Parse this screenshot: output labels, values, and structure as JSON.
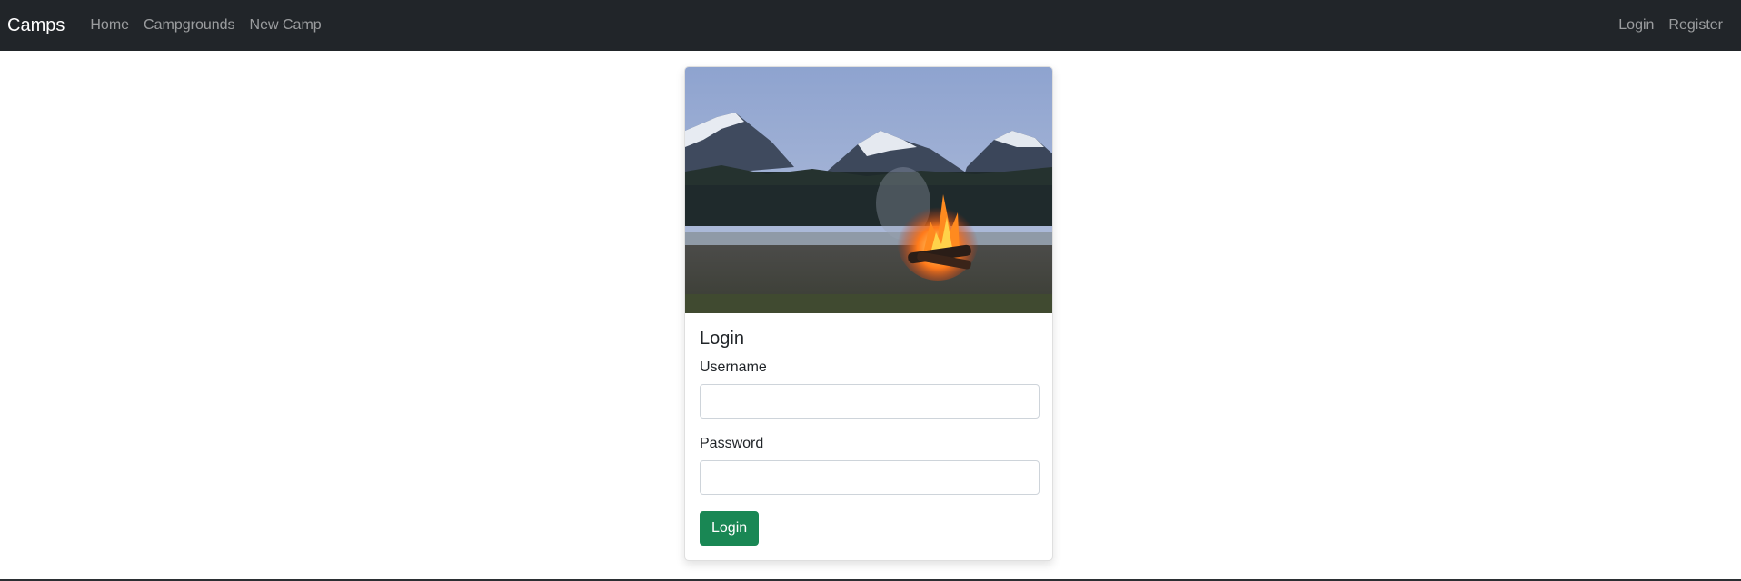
{
  "navbar": {
    "brand": "Camps",
    "links": [
      {
        "label": "Home"
      },
      {
        "label": "Campgrounds"
      },
      {
        "label": "New Camp"
      }
    ],
    "right_links": [
      {
        "label": "Login"
      },
      {
        "label": "Register"
      }
    ]
  },
  "card": {
    "image_icon": "campfire-mountain-photo",
    "title": "Login",
    "username_label": "Username",
    "username_value": "",
    "password_label": "Password",
    "password_value": "",
    "submit_label": "Login"
  },
  "colors": {
    "navbar_bg": "#212529",
    "button_success": "#198754"
  }
}
